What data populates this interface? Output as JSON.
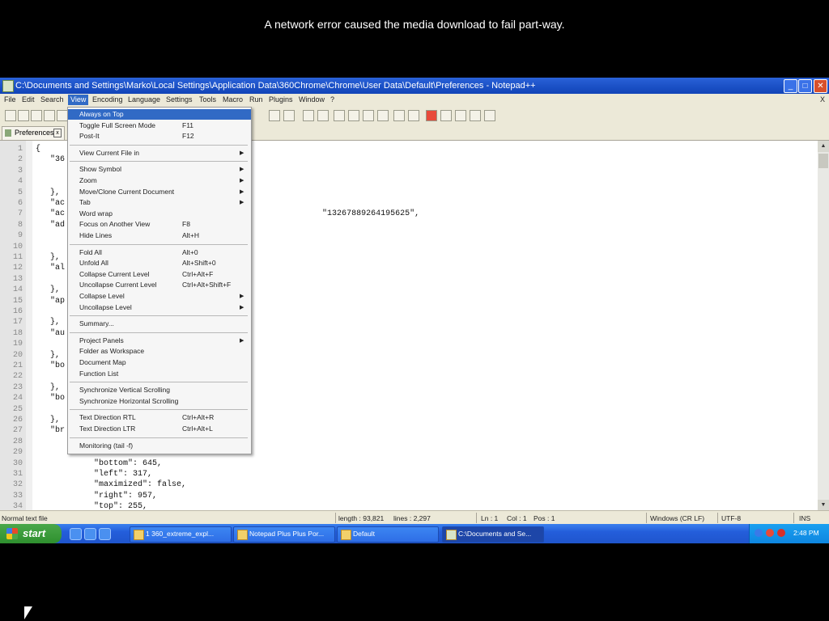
{
  "overlay": {
    "message": "A network error caused the media download to fail part-way.",
    "close_glyph": "X"
  },
  "window": {
    "title": "C:\\Documents and Settings\\Marko\\Local Settings\\Application Data\\360Chrome\\Chrome\\User Data\\Default\\Preferences - Notepad++",
    "min": "_",
    "max": "□",
    "close": "✕"
  },
  "menubar": {
    "items": [
      "File",
      "Edit",
      "Search",
      "View",
      "Encoding",
      "Language",
      "Settings",
      "Tools",
      "Macro",
      "Run",
      "Plugins",
      "Window",
      "?"
    ],
    "close": "X"
  },
  "tab": {
    "label": "Preferences",
    "close": "x"
  },
  "editor": {
    "lines": [
      {
        "n": "1",
        "t": "{"
      },
      {
        "n": "2",
        "t": "   \"36"
      },
      {
        "n": "3",
        "t": ""
      },
      {
        "n": "4",
        "t": ""
      },
      {
        "n": "5",
        "t": "   },"
      },
      {
        "n": "6",
        "t": "   \"ac"
      },
      {
        "n": "7",
        "t": "   \"ac                                                     \"13267889264195625\","
      },
      {
        "n": "8",
        "t": "   \"ad"
      },
      {
        "n": "9",
        "t": ""
      },
      {
        "n": "10",
        "t": ""
      },
      {
        "n": "11",
        "t": "   },"
      },
      {
        "n": "12",
        "t": "   \"al"
      },
      {
        "n": "13",
        "t": ""
      },
      {
        "n": "14",
        "t": "   },"
      },
      {
        "n": "15",
        "t": "   \"ap"
      },
      {
        "n": "16",
        "t": ""
      },
      {
        "n": "17",
        "t": "   },"
      },
      {
        "n": "18",
        "t": "   \"au"
      },
      {
        "n": "19",
        "t": ""
      },
      {
        "n": "20",
        "t": "   },"
      },
      {
        "n": "21",
        "t": "   \"bo"
      },
      {
        "n": "22",
        "t": ""
      },
      {
        "n": "23",
        "t": "   },"
      },
      {
        "n": "24",
        "t": "   \"bo"
      },
      {
        "n": "25",
        "t": ""
      },
      {
        "n": "26",
        "t": "   },"
      },
      {
        "n": "27",
        "t": "   \"br"
      },
      {
        "n": "28",
        "t": ""
      },
      {
        "n": "29",
        "t": ""
      },
      {
        "n": "30",
        "t": "            \"bottom\": 645,"
      },
      {
        "n": "31",
        "t": "            \"left\": 317,"
      },
      {
        "n": "32",
        "t": "            \"maximized\": false,"
      },
      {
        "n": "33",
        "t": "            \"right\": 957,"
      },
      {
        "n": "34",
        "t": "            \"top\": 255,"
      }
    ]
  },
  "view_menu": {
    "items": [
      {
        "label": "Always on Top",
        "shortcut": "",
        "submenu": false,
        "highlight": true
      },
      {
        "label": "Toggle Full Screen Mode",
        "shortcut": "F11",
        "submenu": false
      },
      {
        "label": "Post-It",
        "shortcut": "F12",
        "submenu": false
      },
      {
        "sep": true
      },
      {
        "label": "View Current File in",
        "shortcut": "",
        "submenu": true
      },
      {
        "sep": true
      },
      {
        "label": "Show Symbol",
        "shortcut": "",
        "submenu": true
      },
      {
        "label": "Zoom",
        "shortcut": "",
        "submenu": true
      },
      {
        "label": "Move/Clone Current Document",
        "shortcut": "",
        "submenu": true
      },
      {
        "label": "Tab",
        "shortcut": "",
        "submenu": true
      },
      {
        "label": "Word wrap",
        "shortcut": "",
        "submenu": false
      },
      {
        "label": "Focus on Another View",
        "shortcut": "F8",
        "submenu": false
      },
      {
        "label": "Hide Lines",
        "shortcut": "Alt+H",
        "submenu": false
      },
      {
        "sep": true
      },
      {
        "label": "Fold All",
        "shortcut": "Alt+0",
        "submenu": false
      },
      {
        "label": "Unfold All",
        "shortcut": "Alt+Shift+0",
        "submenu": false
      },
      {
        "label": "Collapse Current Level",
        "shortcut": "Ctrl+Alt+F",
        "submenu": false
      },
      {
        "label": "Uncollapse Current Level",
        "shortcut": "Ctrl+Alt+Shift+F",
        "submenu": false
      },
      {
        "label": "Collapse Level",
        "shortcut": "",
        "submenu": true
      },
      {
        "label": "Uncollapse Level",
        "shortcut": "",
        "submenu": true
      },
      {
        "sep": true
      },
      {
        "label": "Summary...",
        "shortcut": "",
        "submenu": false
      },
      {
        "sep": true
      },
      {
        "label": "Project Panels",
        "shortcut": "",
        "submenu": true
      },
      {
        "label": "Folder as Workspace",
        "shortcut": "",
        "submenu": false
      },
      {
        "label": "Document Map",
        "shortcut": "",
        "submenu": false
      },
      {
        "label": "Function List",
        "shortcut": "",
        "submenu": false
      },
      {
        "sep": true
      },
      {
        "label": "Synchronize Vertical Scrolling",
        "shortcut": "",
        "submenu": false
      },
      {
        "label": "Synchronize Horizontal Scrolling",
        "shortcut": "",
        "submenu": false
      },
      {
        "sep": true
      },
      {
        "label": "Text Direction RTL",
        "shortcut": "Ctrl+Alt+R",
        "submenu": false
      },
      {
        "label": "Text Direction LTR",
        "shortcut": "Ctrl+Alt+L",
        "submenu": false
      },
      {
        "sep": true
      },
      {
        "label": "Monitoring (tail -f)",
        "shortcut": "",
        "submenu": false
      }
    ]
  },
  "statusbar": {
    "file_type": "Normal text file",
    "length": "length : 93,821",
    "lines": "lines : 2,297",
    "ln": "Ln : 1",
    "col": "Col : 1",
    "pos": "Pos : 1",
    "eol": "Windows (CR LF)",
    "encoding": "UTF-8",
    "mode": "INS"
  },
  "taskbar": {
    "start": "start",
    "tasks": [
      {
        "label": "1 360_extreme_expl..."
      },
      {
        "label": "Notepad Plus Plus Por..."
      },
      {
        "label": "Default"
      },
      {
        "label": "C:\\Documents and Se..."
      }
    ],
    "clock": "2:48 PM"
  }
}
